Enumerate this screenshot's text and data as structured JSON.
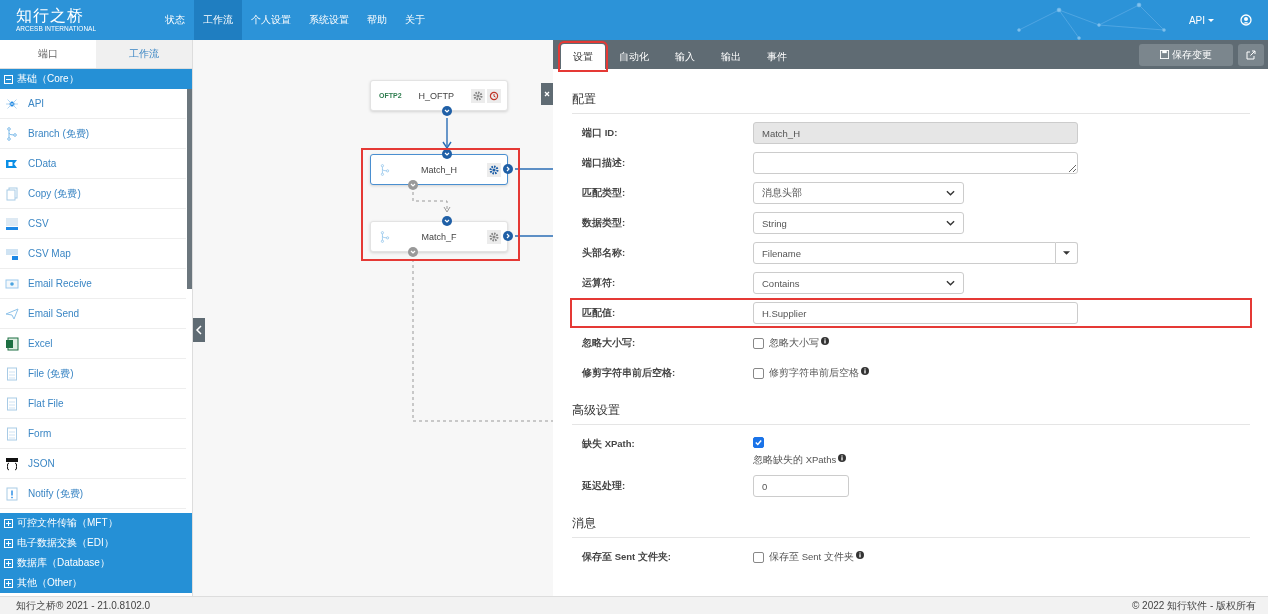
{
  "header": {
    "logo": "知行之桥",
    "logo_subtitle": "ARCESB INTERNATIONAL",
    "nav": [
      {
        "label": "状态",
        "selected": false
      },
      {
        "label": "工作流",
        "selected": true
      },
      {
        "label": "个人设置",
        "selected": false
      },
      {
        "label": "系统设置",
        "selected": false
      },
      {
        "label": "帮助",
        "selected": false
      },
      {
        "label": "关于",
        "selected": false
      }
    ],
    "user_menu": "API"
  },
  "sidebar": {
    "tabs": [
      {
        "label": "端口",
        "selected": true
      },
      {
        "label": "工作流",
        "selected": false
      }
    ],
    "categories": [
      {
        "label": "基础（Core）",
        "expanded": true,
        "items": [
          {
            "label": "API"
          },
          {
            "label": "Branch (免费)"
          },
          {
            "label": "CData"
          },
          {
            "label": "Copy (免费)"
          },
          {
            "label": "CSV"
          },
          {
            "label": "CSV Map"
          },
          {
            "label": "Email Receive"
          },
          {
            "label": "Email Send"
          },
          {
            "label": "Excel"
          },
          {
            "label": "File (免费)"
          },
          {
            "label": "Flat File"
          },
          {
            "label": "Form"
          },
          {
            "label": "JSON"
          },
          {
            "label": "Notify (免费)"
          }
        ]
      },
      {
        "label": "可控文件传输（MFT）",
        "expanded": false
      },
      {
        "label": "电子数据交换（EDI）",
        "expanded": false
      },
      {
        "label": "数据库（Database）",
        "expanded": false
      },
      {
        "label": "其他（Other）",
        "expanded": false
      }
    ]
  },
  "canvas": {
    "highlight_frame": true,
    "nodes": [
      {
        "label": "H_OFTP",
        "kind": "oftp",
        "icon_text": "OFTP2",
        "selected": false
      },
      {
        "label": "Match_H",
        "kind": "branch",
        "selected": true
      },
      {
        "label": "Match_F",
        "kind": "branch",
        "selected": false
      }
    ]
  },
  "panel": {
    "tabs": [
      {
        "label": "设置",
        "selected": true,
        "highlighted": true
      },
      {
        "label": "自动化",
        "selected": false,
        "highlighted": false
      },
      {
        "label": "输入",
        "selected": false,
        "highlighted": false
      },
      {
        "label": "输出",
        "selected": false,
        "highlighted": false
      },
      {
        "label": "事件",
        "selected": false,
        "highlighted": false
      }
    ],
    "save_button": "保存变更",
    "sections": [
      {
        "title": "配置",
        "fields": [
          {
            "label": "端口 ID:",
            "kind": "text",
            "value": "Match_H",
            "disabled": true,
            "highlighted": false
          },
          {
            "label": "端口描述:",
            "kind": "textarea",
            "highlighted": false
          },
          {
            "label": "匹配类型:",
            "kind": "select",
            "value": "消息头部",
            "highlighted": false
          },
          {
            "label": "数据类型:",
            "kind": "select",
            "value": "String",
            "highlighted": false
          },
          {
            "label": "头部名称:",
            "kind": "combo",
            "value": "Filename",
            "highlighted": false
          },
          {
            "label": "运算符:",
            "kind": "select",
            "value": "Contains",
            "highlighted": false
          },
          {
            "label": "匹配值:",
            "kind": "text",
            "value": "H.Supplier",
            "disabled": false,
            "highlighted": true
          },
          {
            "label": "忽略大小写:",
            "kind": "checkbox",
            "checked": false,
            "text": "忽略大小写",
            "highlighted": false
          },
          {
            "label": "修剪字符串前后空格:",
            "kind": "checkbox",
            "checked": false,
            "text": "修剪字符串前后空格",
            "highlighted": false
          }
        ]
      },
      {
        "title": "高级设置",
        "fields": [
          {
            "label": "缺失 XPath:",
            "kind": "checkbox-stacked",
            "checked": true,
            "text": "忽略缺失的 XPaths",
            "highlighted": false
          },
          {
            "label": "延迟处理:",
            "kind": "number",
            "value": "0",
            "highlighted": false
          }
        ]
      },
      {
        "title": "消息",
        "fields": [
          {
            "label": "保存至 Sent 文件夹:",
            "kind": "checkbox",
            "checked": false,
            "text": "保存至 Sent 文件夹",
            "highlighted": false
          }
        ]
      }
    ]
  },
  "footer": {
    "left": "知行之桥® 2021 - 21.0.8102.0",
    "right": "© 2022 知行软件 - 版权所有"
  }
}
